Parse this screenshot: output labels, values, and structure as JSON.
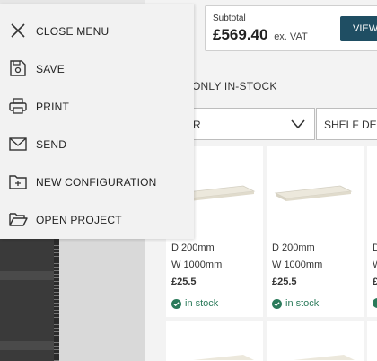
{
  "menu": {
    "items": [
      {
        "label": "CLOSE MENU",
        "icon": "close-icon"
      },
      {
        "label": "SAVE",
        "icon": "save-icon"
      },
      {
        "label": "PRINT",
        "icon": "print-icon"
      },
      {
        "label": "SEND",
        "icon": "mail-icon"
      },
      {
        "label": "NEW CONFIGURATION",
        "icon": "new-folder-icon"
      },
      {
        "label": "OPEN PROJECT",
        "icon": "open-folder-icon"
      }
    ]
  },
  "summary": {
    "subtotal_label": "Subtotal",
    "subtotal_value": "£569.40",
    "vat_note": "ex. VAT",
    "view_label": "VIEW"
  },
  "filters": {
    "only_in_stock": "ONLY IN-STOCK",
    "select_value": "R",
    "depth_label": "SHELF DEP"
  },
  "products": [
    {
      "depth": "D 200mm",
      "width": "W 1000mm",
      "price": "£25.5",
      "stock": "in stock"
    },
    {
      "depth": "D 200mm",
      "width": "W 1000mm",
      "price": "£25.5",
      "stock": "in stock"
    },
    {
      "depth": "D",
      "width": "W",
      "price": "£",
      "stock": ""
    }
  ],
  "colors": {
    "accent": "#1f4e63",
    "in_stock": "#2a7a5a"
  }
}
